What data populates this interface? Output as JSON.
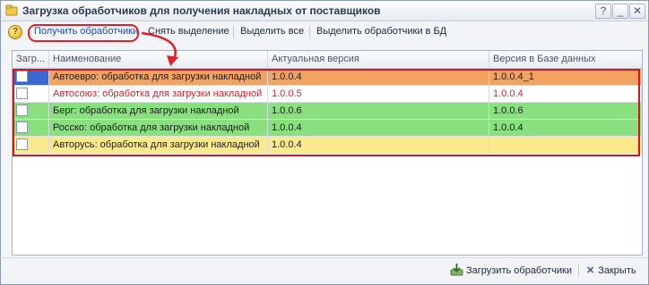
{
  "window": {
    "title": "Загрузка обработчиков для получения накладных от поставщиков"
  },
  "toolbar": {
    "get_handlers": "Получить обработчики",
    "clear_selection": "Снять выделение",
    "select_all": "Выделить все",
    "select_in_db": "Выделить обработчики в БД"
  },
  "table": {
    "headers": {
      "load": "Загр...",
      "name": "Наименование",
      "actual_version": "Актуальная версия",
      "db_version": "Версия в Базе данных"
    },
    "rows": [
      {
        "name": "Автоевро: обработка для загрузки накладной",
        "actual_version": "1.0.0.4",
        "db_version": "1.0.0.4_1",
        "bg": "#f3a361",
        "color": "#1d1d1d"
      },
      {
        "name": "Автосоюз: обработка для загрузки накладной",
        "actual_version": "1.0.0.5",
        "db_version": "1.0.0.4",
        "bg": "#ffffff",
        "color": "#e0202a"
      },
      {
        "name": "Берг: обработка для загрузки накладной",
        "actual_version": "1.0.0.6",
        "db_version": "1.0.0.6",
        "bg": "#88e07e",
        "color": "#1d1d1d"
      },
      {
        "name": "Росско: обработка для загрузки накладной",
        "actual_version": "1.0.0.4",
        "db_version": "1.0.0.4",
        "bg": "#88e07e",
        "color": "#1d1d1d"
      },
      {
        "name": "Авторусь: обработка для загрузки накладной",
        "actual_version": "1.0.0.4",
        "db_version": "",
        "bg": "#fbe98e",
        "color": "#1d1d1d"
      }
    ]
  },
  "footer": {
    "load_handlers": "Загрузить обработчики",
    "close": "Закрыть"
  },
  "colors": {
    "highlight_red": "#e0202a",
    "selection_blue": "#3a66d6"
  }
}
